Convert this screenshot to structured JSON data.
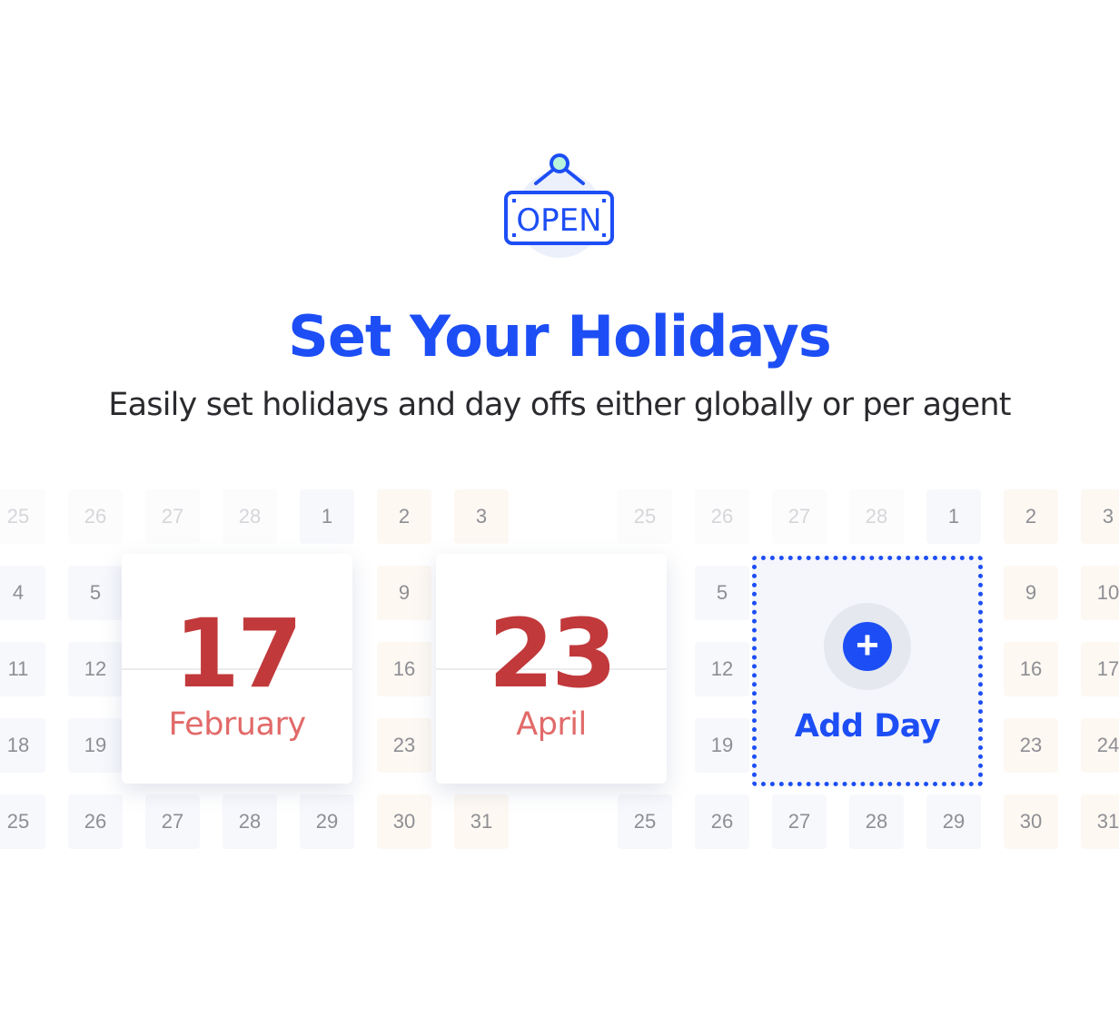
{
  "header": {
    "icon": "open-sign-icon",
    "icon_text": "OPEN",
    "title": "Set Your Holidays",
    "subtitle": "Easily set holidays and day offs either globally or per agent"
  },
  "calendars": [
    {
      "rows": [
        [
          "25",
          "26",
          "27",
          "28",
          "1",
          "2",
          "3"
        ],
        [
          "4",
          "5",
          null,
          null,
          null,
          "9",
          null
        ],
        [
          "11",
          "12",
          null,
          null,
          null,
          "16",
          null
        ],
        [
          "18",
          "19",
          null,
          null,
          null,
          "23",
          null
        ],
        [
          "25",
          "26",
          "27",
          "28",
          "29",
          "30",
          "31"
        ]
      ]
    },
    {
      "rows": [
        [
          "25",
          "26",
          "27",
          "28",
          "1",
          "2",
          "3"
        ],
        [
          null,
          "5",
          null,
          null,
          null,
          "9",
          "10"
        ],
        [
          null,
          "12",
          null,
          null,
          null,
          "16",
          "17"
        ],
        [
          null,
          "19",
          null,
          null,
          null,
          "23",
          "24"
        ],
        [
          "25",
          "26",
          "27",
          "28",
          "29",
          "30",
          "31"
        ]
      ]
    }
  ],
  "holidays": [
    {
      "day": "17",
      "month": "February"
    },
    {
      "day": "23",
      "month": "April"
    }
  ],
  "add_day": {
    "label": "Add Day",
    "icon": "plus-circle-icon"
  },
  "colors": {
    "accent": "#1d4ef5",
    "holiday_day": "#c1393b",
    "holiday_month": "#e16a69",
    "weekend_tile": "#fdf8f2"
  }
}
